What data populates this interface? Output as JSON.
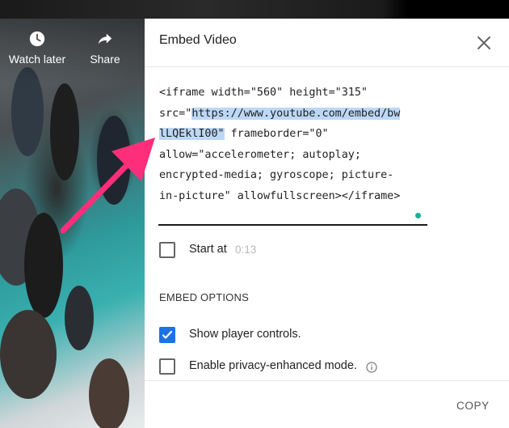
{
  "video_overlay": {
    "watch_later_label": "Watch later",
    "share_label": "Share"
  },
  "dialog": {
    "title": "Embed Video",
    "embed_code": {
      "line1": "<iframe width=\"560\" height=\"315\"",
      "line2_prefix": "src=\"",
      "line2_url": "https://www.youtube.com/embed/bw",
      "line3_url": "lLQEklI00\"",
      "line3_suffix": " frameborder=\"0\"",
      "line4": "allow=\"accelerometer; autoplay;",
      "line5": "encrypted-media; gyroscope; picture-",
      "line6": "in-picture\" allowfullscreen></iframe>"
    },
    "start_at": {
      "label": "Start at",
      "time": "0:13",
      "checked": false
    },
    "embed_options_heading": "EMBED OPTIONS",
    "options": [
      {
        "label": "Show player controls.",
        "checked": true
      },
      {
        "label": "Enable privacy-enhanced mode.",
        "checked": false
      }
    ],
    "copy_label": "COPY"
  },
  "colors": {
    "accent": "#1a73e8",
    "highlight": "#bcd8f6",
    "arrow": "#ff2e7a",
    "dot": "#19b09a"
  },
  "icons": [
    "clock-icon",
    "share-icon",
    "close-icon",
    "checkmark-icon",
    "info-icon"
  ]
}
